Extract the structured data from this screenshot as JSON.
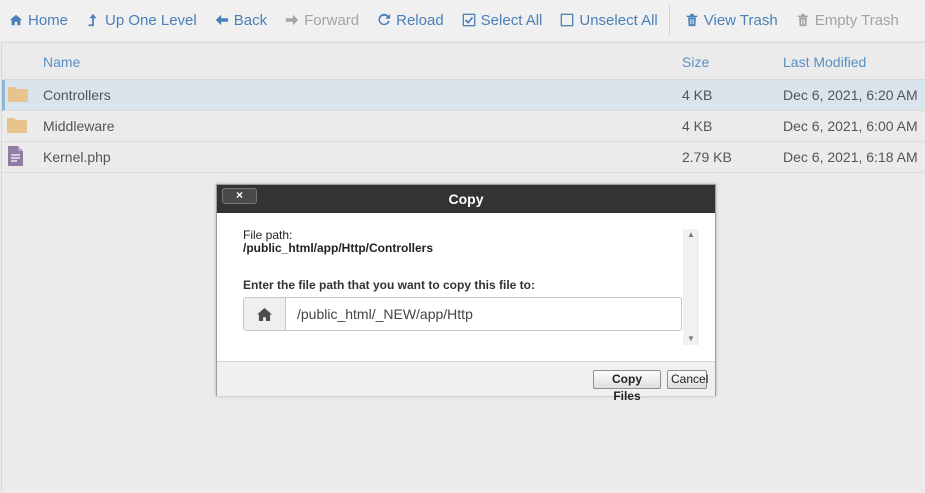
{
  "toolbar": {
    "home": "Home",
    "up": "Up One Level",
    "back": "Back",
    "forward": "Forward",
    "reload": "Reload",
    "select_all": "Select All",
    "unselect_all": "Unselect All",
    "view_trash": "View Trash",
    "empty_trash": "Empty Trash"
  },
  "columns": {
    "name": "Name",
    "size": "Size",
    "modified": "Last Modified"
  },
  "files": [
    {
      "name": "Controllers",
      "size": "4 KB",
      "modified": "Dec 6, 2021, 6:20 AM",
      "type": "folder",
      "selected": true
    },
    {
      "name": "Middleware",
      "size": "4 KB",
      "modified": "Dec 6, 2021, 6:00 AM",
      "type": "folder",
      "selected": false
    },
    {
      "name": "Kernel.php",
      "size": "2.79 KB",
      "modified": "Dec 6, 2021, 6:18 AM",
      "type": "file",
      "selected": false
    }
  ],
  "dialog": {
    "title": "Copy",
    "close": "×",
    "file_path_label": "File path:",
    "file_path_value": "/public_html/app/Http/Controllers",
    "dest_label": "Enter the file path that you want to copy this file to:",
    "dest_value": "/public_html/_NEW/app/Http",
    "copy_button": "Copy Files",
    "cancel_button": "Cancel"
  },
  "colors": {
    "accent": "#4a80b9",
    "disabled": "#a3a3a3",
    "folder": "#e7c48d",
    "title_bar": "#333333"
  }
}
